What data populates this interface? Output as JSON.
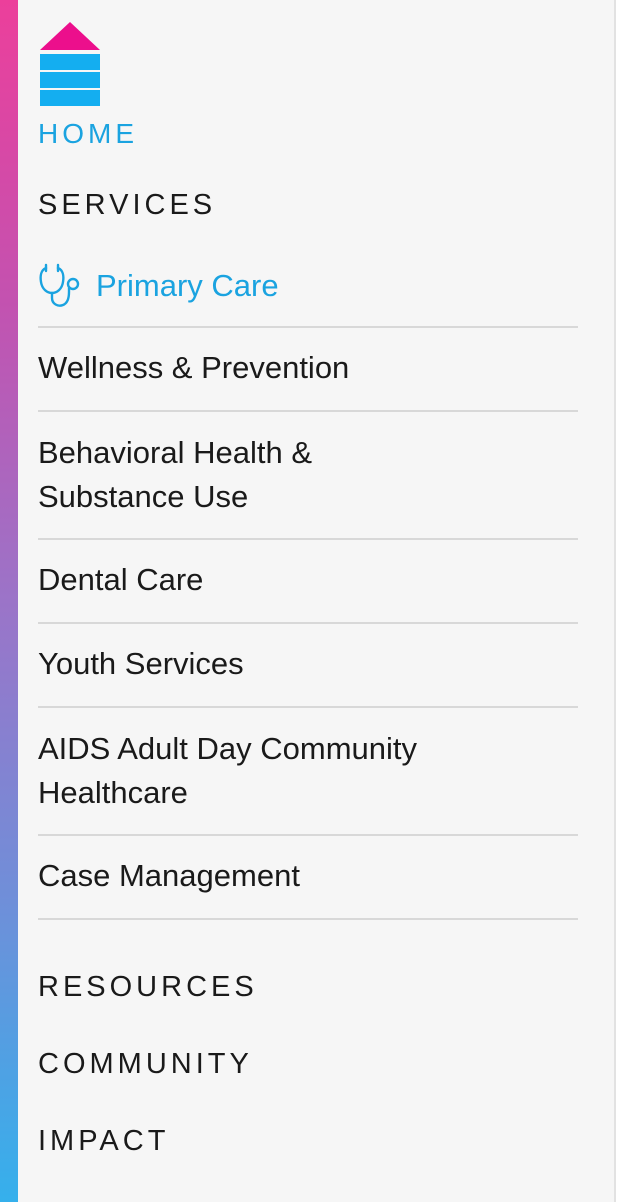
{
  "colors": {
    "accent_blue": "#1aa3e0",
    "accent_pink": "#ec0f8c",
    "text_dark": "#1a1a1a",
    "divider": "#d8d8d8",
    "panel_bg": "#f6f6f6"
  },
  "nav": {
    "home": {
      "label": "HOME",
      "icon": "home-icon"
    },
    "services_heading": "SERVICES",
    "services": [
      {
        "label": "Primary Care",
        "icon": "stethoscope-icon",
        "active": true
      },
      {
        "label": "Wellness & Prevention"
      },
      {
        "label": "Behavioral Health & Substance Use"
      },
      {
        "label": "Dental Care"
      },
      {
        "label": "Youth Services"
      },
      {
        "label": "AIDS Adult Day Community Healthcare"
      },
      {
        "label": "Case Management"
      }
    ],
    "resources": "RESOURCES",
    "community": "COMMUNITY",
    "impact": "IMPACT"
  }
}
